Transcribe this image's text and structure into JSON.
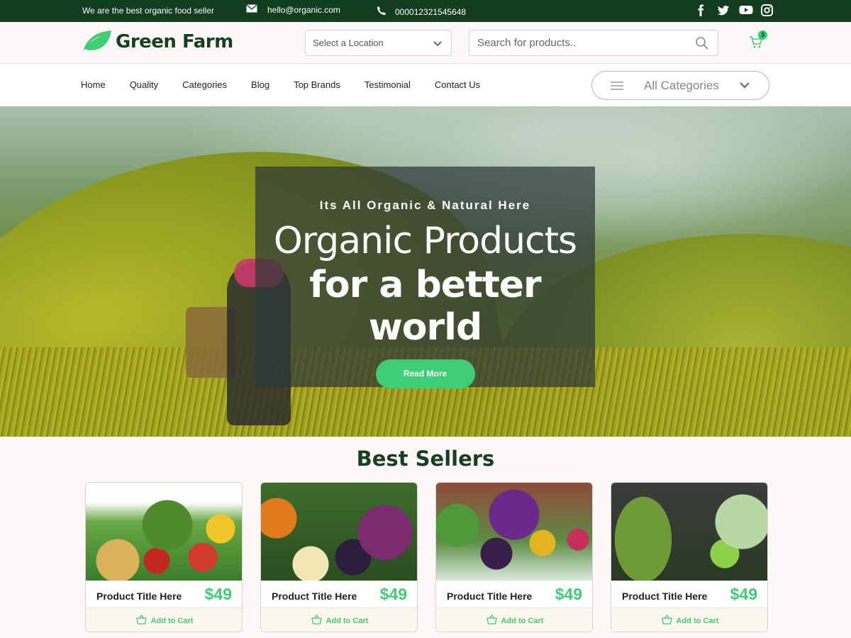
{
  "topbar": {
    "tagline": "We are the best organic food seller",
    "email": "hello@organic.com",
    "phone": "000012321545648",
    "social_icons": [
      "facebook-icon",
      "twitter-icon",
      "youtube-icon",
      "instagram-icon"
    ]
  },
  "header": {
    "brand": "Green Farm",
    "location_placeholder": "Select a Location",
    "search_placeholder": "Search for products..",
    "cart_count": "3"
  },
  "nav": {
    "items": [
      "Home",
      "Quality",
      "Categories",
      "Blog",
      "Top Brands",
      "Testimonial",
      "Contact Us"
    ],
    "all_categories": "All Categories"
  },
  "hero": {
    "subtitle": "Its All Organic & Natural Here",
    "title_line1": "Organic Products",
    "title_line2": "for a better world",
    "button": "Read More"
  },
  "best_sellers": {
    "title": "Best Sellers",
    "products": [
      {
        "title": "Product Title Here",
        "price": "$49",
        "button": "Add to Cart"
      },
      {
        "title": "Product Title Here",
        "price": "$49",
        "button": "Add to Cart"
      },
      {
        "title": "Product Title Here",
        "price": "$49",
        "button": "Add to Cart"
      },
      {
        "title": "Product Title Here",
        "price": "$49",
        "button": "Add to Cart"
      }
    ]
  },
  "colors": {
    "topbar_bg": "#123d1e",
    "brand_dark": "#173f23",
    "accent_green": "#3ecf76"
  }
}
